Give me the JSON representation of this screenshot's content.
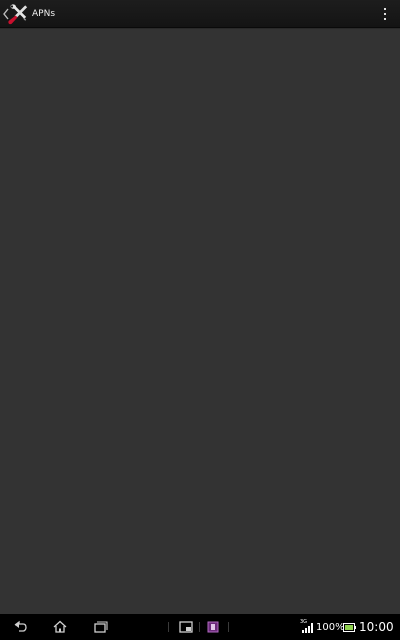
{
  "action_bar": {
    "title": "APNs",
    "icons": {
      "back": "chevron-left-icon",
      "app": "settings-tools-icon",
      "overflow": "overflow-menu-icon"
    }
  },
  "content": {
    "empty": true
  },
  "system_bar": {
    "network_type": "3G",
    "battery_percent": "100%",
    "time": "10:00",
    "icons": {
      "back": "back-icon",
      "home": "home-icon",
      "recent": "recent-apps-icon",
      "small_app_1": "small-app-icon",
      "small_app_2": "small-app-icon-2",
      "signal": "signal-icon",
      "battery": "battery-icon"
    }
  }
}
